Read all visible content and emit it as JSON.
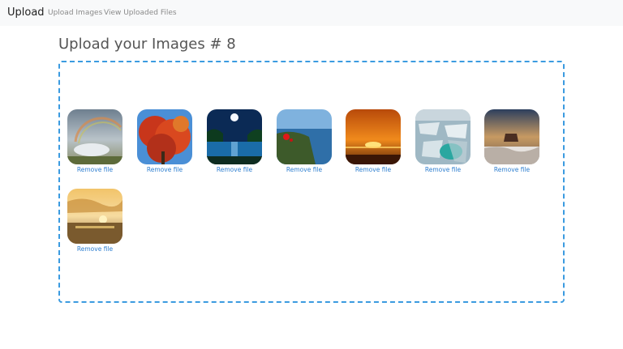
{
  "navbar": {
    "brand": "Upload",
    "links": [
      "Upload Images",
      "View Uploaded Files"
    ]
  },
  "page": {
    "title": "Upload your Images # 8"
  },
  "dropzone": {
    "files": [
      {
        "thumbnail": "rainbow-clouds-landscape",
        "remove_label": "Remove file"
      },
      {
        "thumbnail": "autumn-red-tree",
        "remove_label": "Remove file"
      },
      {
        "thumbnail": "moonlit-tropical-lagoon",
        "remove_label": "Remove file"
      },
      {
        "thumbnail": "coastal-cliff-with-red-flowers",
        "remove_label": "Remove file"
      },
      {
        "thumbnail": "orange-sunset-over-water",
        "remove_label": "Remove file"
      },
      {
        "thumbnail": "frozen-lake-ice-cracks",
        "remove_label": "Remove file"
      },
      {
        "thumbnail": "desert-butte-at-dusk",
        "remove_label": "Remove file"
      },
      {
        "thumbnail": "golden-beach-sunset",
        "remove_label": "Remove file"
      }
    ]
  },
  "colors": {
    "accent": "#3b9be0",
    "link": "#2e7fd0",
    "navbar_bg": "#f8f9fa"
  }
}
